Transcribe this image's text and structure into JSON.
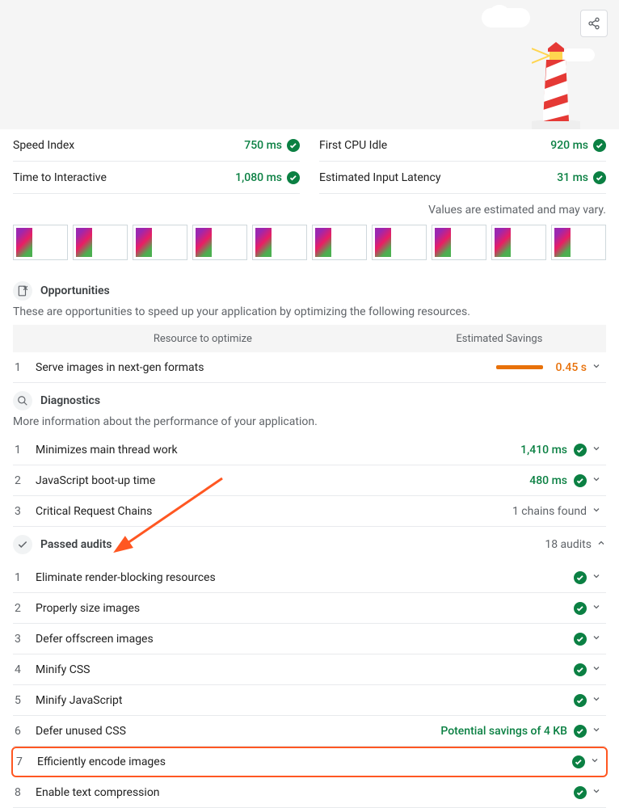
{
  "hero": {
    "share_label": "Share"
  },
  "metrics": {
    "left": [
      {
        "label": "Speed Index",
        "value": "750 ms"
      },
      {
        "label": "Time to Interactive",
        "value": "1,080 ms"
      }
    ],
    "right": [
      {
        "label": "First CPU Idle",
        "value": "920 ms"
      },
      {
        "label": "Estimated Input Latency",
        "value": "31 ms"
      }
    ]
  },
  "estimate_note": "Values are estimated and may vary.",
  "opportunities": {
    "title": "Opportunities",
    "desc": "These are opportunities to speed up your application by optimizing the following resources.",
    "header_left": "Resource to optimize",
    "header_right": "Estimated Savings",
    "rows": [
      {
        "num": "1",
        "label": "Serve images in next-gen formats",
        "value": "0.45 s"
      }
    ]
  },
  "diagnostics": {
    "title": "Diagnostics",
    "desc": "More information about the performance of your application.",
    "rows": [
      {
        "num": "1",
        "label": "Minimizes main thread work",
        "value": "1,410 ms",
        "status": "pass"
      },
      {
        "num": "2",
        "label": "JavaScript boot-up time",
        "value": "480 ms",
        "status": "pass"
      },
      {
        "num": "3",
        "label": "Critical Request Chains",
        "value": "1 chains found",
        "status": "info"
      }
    ]
  },
  "passed": {
    "title": "Passed audits",
    "count_label": "18 audits",
    "rows": [
      {
        "num": "1",
        "label": "Eliminate render-blocking resources",
        "value": ""
      },
      {
        "num": "2",
        "label": "Properly size images",
        "value": ""
      },
      {
        "num": "3",
        "label": "Defer offscreen images",
        "value": ""
      },
      {
        "num": "4",
        "label": "Minify CSS",
        "value": ""
      },
      {
        "num": "5",
        "label": "Minify JavaScript",
        "value": ""
      },
      {
        "num": "6",
        "label": "Defer unused CSS",
        "value": "Potential savings of 4 KB"
      },
      {
        "num": "7",
        "label": "Efficiently encode images",
        "value": ""
      },
      {
        "num": "8",
        "label": "Enable text compression",
        "value": ""
      }
    ]
  },
  "highlight_index": 6
}
